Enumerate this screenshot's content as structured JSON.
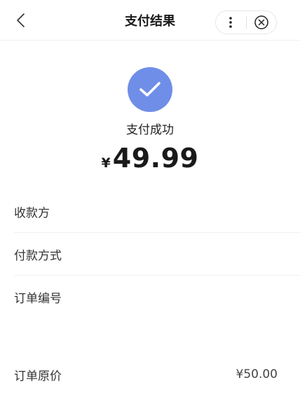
{
  "nav": {
    "title": "支付结果"
  },
  "result": {
    "status": "支付成功",
    "currency_symbol": "¥",
    "amount": "49.99"
  },
  "details": [
    {
      "label": "收款方",
      "value": ""
    },
    {
      "label": "付款方式",
      "value": ""
    },
    {
      "label": "订单编号",
      "value": ""
    }
  ],
  "original_price": {
    "label": "订单原价",
    "value": "¥50.00"
  },
  "colors": {
    "success_accent": "#6f8ee8"
  }
}
